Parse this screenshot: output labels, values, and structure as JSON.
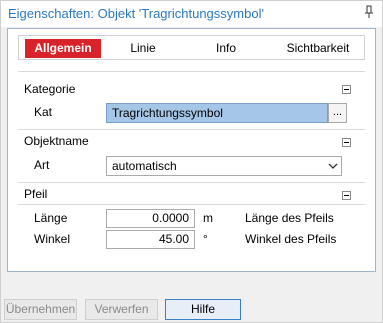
{
  "window": {
    "title": "Eigenschaften: Objekt 'Tragrichtungssymbol'",
    "pin_icon": "pin-icon"
  },
  "tabs": [
    {
      "label": "Allgemein",
      "active": true
    },
    {
      "label": "Linie",
      "active": false
    },
    {
      "label": "Info",
      "active": false
    },
    {
      "label": "Sichtbarkeit",
      "active": false
    }
  ],
  "groups": {
    "kategorie": {
      "title": "Kategorie",
      "kat_label": "Kat",
      "kat_value": "Tragrichtungssymbol",
      "browse_label": "..."
    },
    "objektname": {
      "title": "Objektname",
      "art_label": "Art",
      "art_value": "automatisch"
    },
    "pfeil": {
      "title": "Pfeil",
      "laenge_label": "Länge",
      "laenge_value": "0.0000",
      "laenge_unit": "m",
      "laenge_desc": "Länge des Pfeils",
      "winkel_label": "Winkel",
      "winkel_value": "45.00",
      "winkel_unit": "°",
      "winkel_desc": "Winkel des Pfeils"
    }
  },
  "buttons": {
    "apply": "Übernehmen",
    "discard": "Verwerfen",
    "help": "Hilfe"
  },
  "colors": {
    "accent_tab": "#d9232a",
    "title_text": "#2b79c2",
    "selected_field": "#a6c6e8"
  }
}
